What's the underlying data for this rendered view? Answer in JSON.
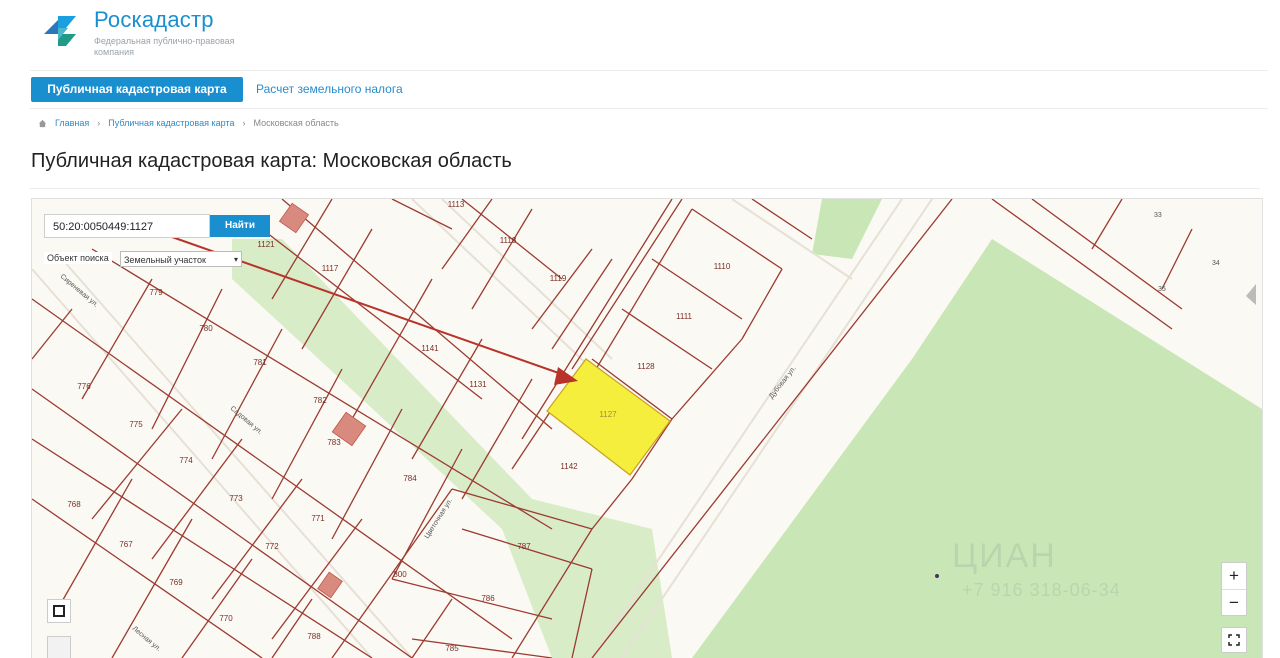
{
  "brand": {
    "name": "Роскадастр",
    "subtitle": "Федеральная публично-правовая компания"
  },
  "nav": {
    "active_tab": "Публичная кадастровая карта",
    "second_tab": "Расчет земельного налога"
  },
  "breadcrumb": {
    "home": "Главная",
    "level1": "Публичная кадастровая карта",
    "current": "Московская область",
    "sep": "›"
  },
  "page": {
    "title": "Публичная кадастровая карта: Московская область"
  },
  "search": {
    "value": "50:20:0050449:1127",
    "button": "Найти"
  },
  "filter": {
    "label": "Объект поиска",
    "value": "Земельный участок",
    "chevron": "▾"
  },
  "zoom": {
    "in": "+",
    "out": "−"
  },
  "watermark": {
    "brand": "ЦИАН",
    "phone": "+7 916 318-06-34"
  },
  "map": {
    "highlight_color": "#f5ee3c",
    "parcel_labels": [
      "1127",
      "1142",
      "1128",
      "1111",
      "1110",
      "1119",
      "1118",
      "1117",
      "1141",
      "1131",
      "1113",
      "1121",
      "779",
      "780",
      "781",
      "782",
      "783",
      "784",
      "776",
      "775",
      "774",
      "773",
      "771",
      "768",
      "767",
      "769",
      "770",
      "772",
      "787",
      "786",
      "785",
      "788",
      "800"
    ],
    "street_labels": [
      "Сиреневая ул.",
      "Садовая ул.",
      "Цветочная ул.",
      "Дубовая ул.",
      "Лесная ул."
    ],
    "corner_labels": [
      "33",
      "34",
      "35"
    ]
  }
}
